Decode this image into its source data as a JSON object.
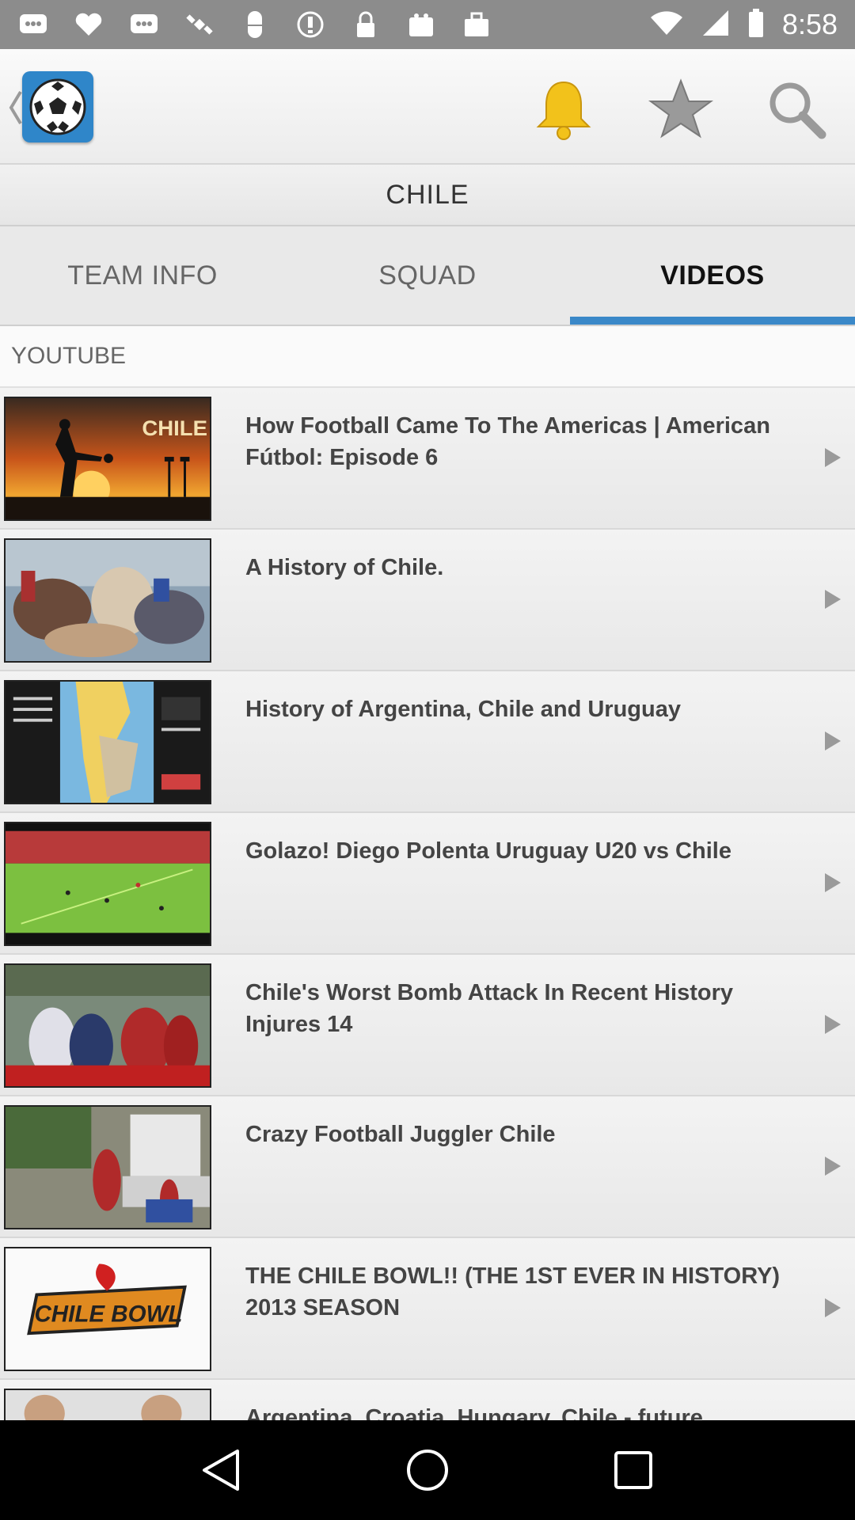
{
  "status_bar": {
    "time": "8:58",
    "icons": [
      "notification-icon",
      "heart-icon",
      "notification-icon",
      "satellite-icon",
      "pill-icon",
      "do-not-disturb-icon",
      "lock-icon",
      "bag-icon",
      "bag-icon"
    ]
  },
  "app_bar": {
    "logo": "soccer-ball-icon",
    "actions": [
      "bell-icon",
      "star-icon",
      "search-icon"
    ],
    "colors": {
      "bell": "#f2c21b",
      "star": "#9a9a9a",
      "search": "#9a9a9a",
      "logo_bg": "#2f86c9"
    }
  },
  "page": {
    "title": "CHILE"
  },
  "tabs": [
    {
      "label": "TEAM INFO",
      "active": false
    },
    {
      "label": "SQUAD",
      "active": false
    },
    {
      "label": "VIDEOS",
      "active": true
    }
  ],
  "accent_color": "#3a88c8",
  "section": {
    "header": "YOUTUBE"
  },
  "videos": [
    {
      "title": "How Football Came To The Americas | American Fútbol: Episode 6"
    },
    {
      "title": "A History of Chile."
    },
    {
      "title": "History of Argentina, Chile and Uruguay"
    },
    {
      "title": "Golazo! Diego Polenta Uruguay U20 vs Chile"
    },
    {
      "title": "Chile's Worst Bomb Attack In Recent History Injures 14"
    },
    {
      "title": "Crazy Football Juggler Chile"
    },
    {
      "title": "THE CHILE BOWL!! (THE 1ST EVER IN HISTORY) 2013 SEASON"
    },
    {
      "title": "Argentina, Croatia, Hungary, Chile - future"
    }
  ],
  "thumbnail_texts": {
    "chile_label": "CHILE",
    "chile_bowl": "CHILE BOWL"
  },
  "nav_bar": {
    "buttons": [
      "back-icon",
      "home-icon",
      "recents-icon"
    ]
  }
}
